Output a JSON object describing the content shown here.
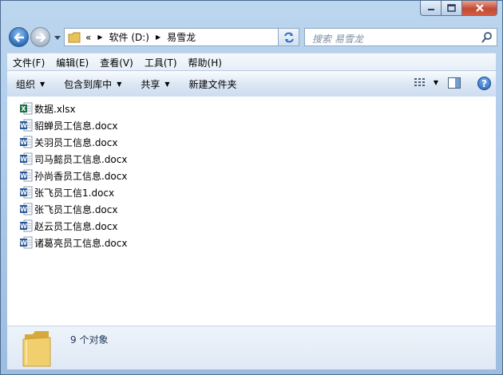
{
  "window": {
    "address": {
      "overflow": "«",
      "crumbs": [
        "软件 (D:)",
        "易雪龙"
      ]
    },
    "search_placeholder": "搜索 易雪龙"
  },
  "menubar": [
    "文件(F)",
    "编辑(E)",
    "查看(V)",
    "工具(T)",
    "帮助(H)"
  ],
  "commandbar": {
    "organize": "组织",
    "include": "包含到库中",
    "share": "共享",
    "new_folder": "新建文件夹",
    "help": "?"
  },
  "files": [
    {
      "name": "数据.xlsx",
      "type": "excel"
    },
    {
      "name": "貂蝉员工信息.docx",
      "type": "word"
    },
    {
      "name": "关羽员工信息.docx",
      "type": "word"
    },
    {
      "name": "司马懿员工信息.docx",
      "type": "word"
    },
    {
      "name": "孙尚香员工信息.docx",
      "type": "word"
    },
    {
      "name": "张飞员工信1.docx",
      "type": "word"
    },
    {
      "name": "张飞员工信息.docx",
      "type": "word"
    },
    {
      "name": "赵云员工信息.docx",
      "type": "word"
    },
    {
      "name": "诸葛亮员工信息.docx",
      "type": "word"
    }
  ],
  "status": {
    "count": "9 个对象"
  },
  "colors": {
    "word": "#2b5797",
    "excel": "#1e7145",
    "folder": "#e8c35a"
  }
}
